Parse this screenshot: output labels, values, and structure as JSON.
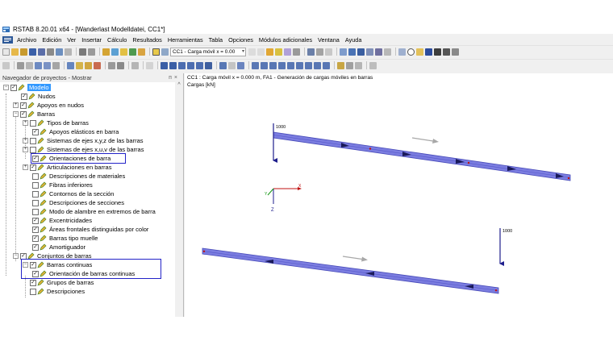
{
  "window": {
    "title": "RSTAB 8.20.01 x64 - [Wanderlast Modelldatei, CC1*]"
  },
  "menu": [
    "Archivo",
    "Edición",
    "Ver",
    "Insertar",
    "Cálculo",
    "Resultados",
    "Herramientas",
    "Tabla",
    "Opciones",
    "Módulos adicionales",
    "Ventana",
    "Ayuda"
  ],
  "toolbar": {
    "load_case": "CC1 - Carga móvil x = 0.00"
  },
  "navigator": {
    "title": "Navegador de proyectos - Mostrar",
    "items": [
      {
        "label": "Modelo",
        "selected": true
      },
      {
        "label": "Nudos"
      },
      {
        "label": "Apoyos en nudos"
      },
      {
        "label": "Barras"
      },
      {
        "label": "Tipos de barras"
      },
      {
        "label": "Apoyos elásticos en barra"
      },
      {
        "label": "Sistemas de ejes x,y,z de las barras"
      },
      {
        "label": "Sistemas de ejes x,u,v de las barras"
      },
      {
        "label": "Orientaciones de barra"
      },
      {
        "label": "Articulaciones en barras"
      },
      {
        "label": "Descripciones de materiales"
      },
      {
        "label": "Fibras inferiores"
      },
      {
        "label": "Contornos de la sección"
      },
      {
        "label": "Descripciones de secciones"
      },
      {
        "label": "Modo de alambre en extremos de barra"
      },
      {
        "label": "Excentricidades"
      },
      {
        "label": "Áreas frontales distinguidas por color"
      },
      {
        "label": "Barras tipo muelle"
      },
      {
        "label": "Amortiguador"
      },
      {
        "label": "Conjuntos de barras"
      },
      {
        "label": "Barras continuas"
      },
      {
        "label": "Orientación de barras continuas"
      },
      {
        "label": "Grupos de barras"
      },
      {
        "label": "Descripciones"
      }
    ]
  },
  "graphics": {
    "info_line1": "CC1 : Carga móvil x = 0.000 m, FA1 -  Generación de cargas móviles en barras",
    "info_line2": "Cargas [kN]",
    "load_label_1": "1000",
    "load_label_2": "1000",
    "axis_x": "X",
    "axis_z": "Z",
    "axis_y": "Y"
  },
  "colors": {
    "member_fill": "#7b7de0",
    "member_edge": "#4649b8",
    "highlight_box": "#2323c8",
    "selection": "#3399ff",
    "load_arrow": "#1e1e8c"
  }
}
